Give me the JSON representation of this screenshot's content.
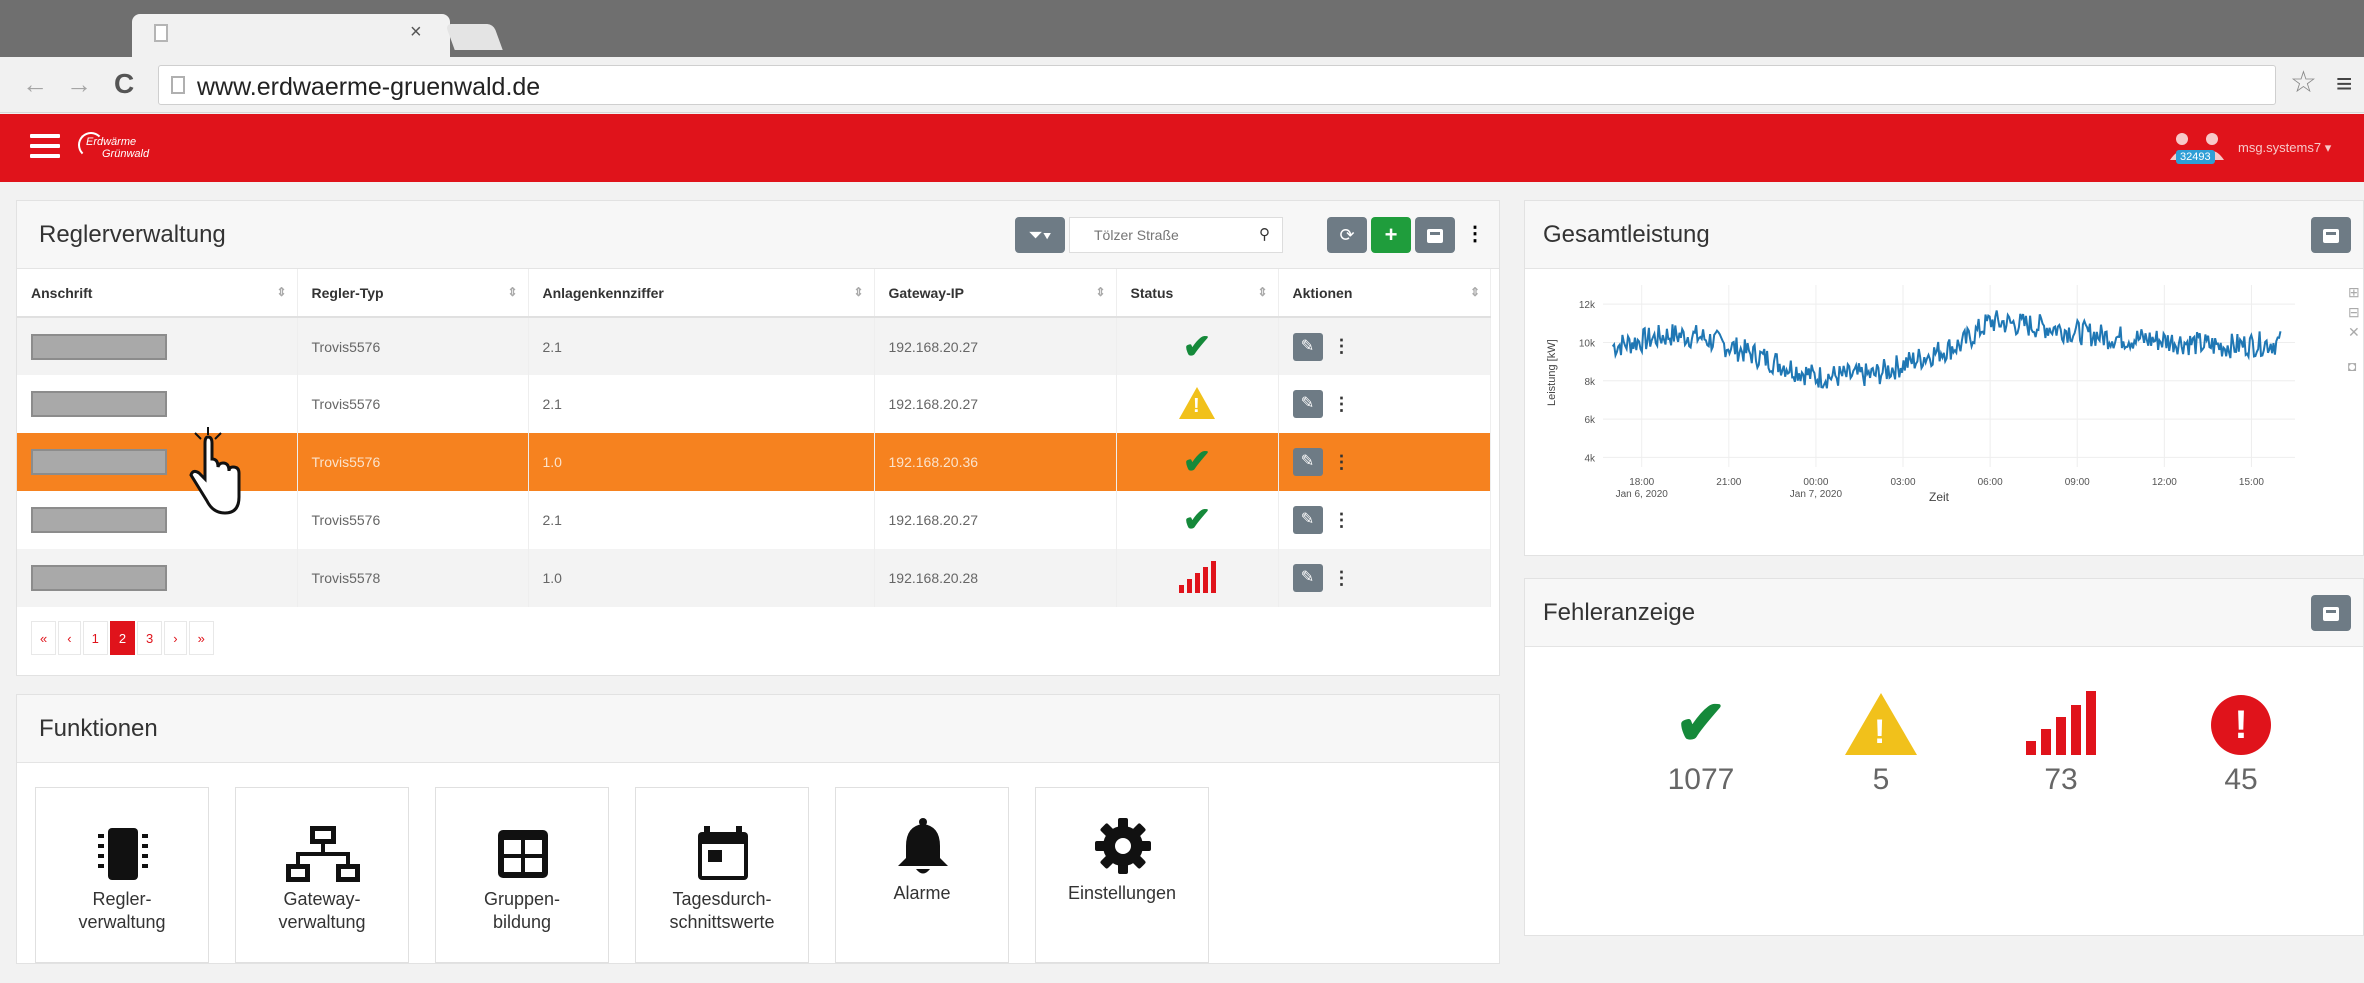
{
  "browser": {
    "url": "www.erdwaerme-gruenwald.de",
    "tab_close": "×"
  },
  "header": {
    "logo_line1": "Erdwärme",
    "logo_line2": "Grünwald",
    "user_badge": "32493",
    "user_name": "msg.systems7",
    "brand_color": "#e0131b"
  },
  "regler": {
    "title": "Reglerverwaltung",
    "search_placeholder": "Tölzer Straße",
    "columns": [
      "Anschrift",
      "Regler-Typ",
      "Anlagenkennziffer",
      "Gateway-IP",
      "Status",
      "Aktionen"
    ],
    "rows": [
      {
        "typ": "Trovis5576",
        "kennziffer": "2.1",
        "ip": "192.168.20.27",
        "status": "ok"
      },
      {
        "typ": "Trovis5576",
        "kennziffer": "2.1",
        "ip": "192.168.20.27",
        "status": "warning"
      },
      {
        "typ": "Trovis5576",
        "kennziffer": "1.0",
        "ip": "192.168.20.36",
        "status": "ok"
      },
      {
        "typ": "Trovis5576",
        "kennziffer": "2.1",
        "ip": "192.168.20.27",
        "status": "ok"
      },
      {
        "typ": "Trovis5578",
        "kennziffer": "1.0",
        "ip": "192.168.20.28",
        "status": "signal"
      }
    ],
    "pager": [
      "«",
      "‹",
      "1",
      "2",
      "3",
      "›",
      "»"
    ],
    "pager_active": "2"
  },
  "funktionen": {
    "title": "Funktionen",
    "tiles": [
      {
        "line1": "Regler-",
        "line2": "verwaltung",
        "icon": "chip-icon"
      },
      {
        "line1": "Gateway-",
        "line2": "verwaltung",
        "icon": "network-icon"
      },
      {
        "line1": "Gruppen-",
        "line2": "bildung",
        "icon": "grid-icon"
      },
      {
        "line1": "Tagesdurch-",
        "line2": "schnittswerte",
        "icon": "calendar-icon"
      },
      {
        "line1": "Alarme",
        "line2": "",
        "icon": "bell-icon"
      },
      {
        "line1": "Einstellungen",
        "line2": "",
        "icon": "gear-icon"
      }
    ]
  },
  "gesamtleistung": {
    "title": "Gesamtleistung"
  },
  "chart_data": {
    "type": "line",
    "xlabel": "Zeit",
    "ylabel": "Leistung [kW]",
    "yticks": [
      "12k",
      "10k",
      "8k",
      "6k",
      "4k"
    ],
    "ylim": [
      3500,
      13000
    ],
    "xticks": [
      {
        "t": "18:00",
        "sub": "Jan 6, 2020"
      },
      {
        "t": "21:00",
        "sub": ""
      },
      {
        "t": "00:00",
        "sub": "Jan 7, 2020"
      },
      {
        "t": "03:00",
        "sub": ""
      },
      {
        "t": "06:00",
        "sub": ""
      },
      {
        "t": "09:00",
        "sub": ""
      },
      {
        "t": "12:00",
        "sub": ""
      },
      {
        "t": "15:00",
        "sub": ""
      }
    ],
    "series": [
      {
        "color": "#1f77b4",
        "keypoints": [
          {
            "x": "Jan 6, 2020 17:00",
            "y": 9800
          },
          {
            "x": "Jan 6, 2020 19:00",
            "y": 10400
          },
          {
            "x": "Jan 6, 2020 20:00",
            "y": 10300
          },
          {
            "x": "Jan 6, 2020 22:00",
            "y": 9300
          },
          {
            "x": "Jan 7, 2020 00:00",
            "y": 8200
          },
          {
            "x": "Jan 7, 2020 02:00",
            "y": 8300
          },
          {
            "x": "Jan 7, 2020 04:00",
            "y": 9400
          },
          {
            "x": "Jan 7, 2020 05:00",
            "y": 9900
          },
          {
            "x": "Jan 7, 2020 06:00",
            "y": 11100
          },
          {
            "x": "Jan 7, 2020 08:00",
            "y": 10800
          },
          {
            "x": "Jan 7, 2020 10:00",
            "y": 10300
          },
          {
            "x": "Jan 7, 2020 12:00",
            "y": 10100
          },
          {
            "x": "Jan 7, 2020 14:00",
            "y": 9800
          },
          {
            "x": "Jan 7, 2020 16:00",
            "y": 10000
          }
        ]
      }
    ]
  },
  "fehler": {
    "title": "Fehleranzeige",
    "ok": "1077",
    "warning": "5",
    "signal": "73",
    "error": "45"
  }
}
